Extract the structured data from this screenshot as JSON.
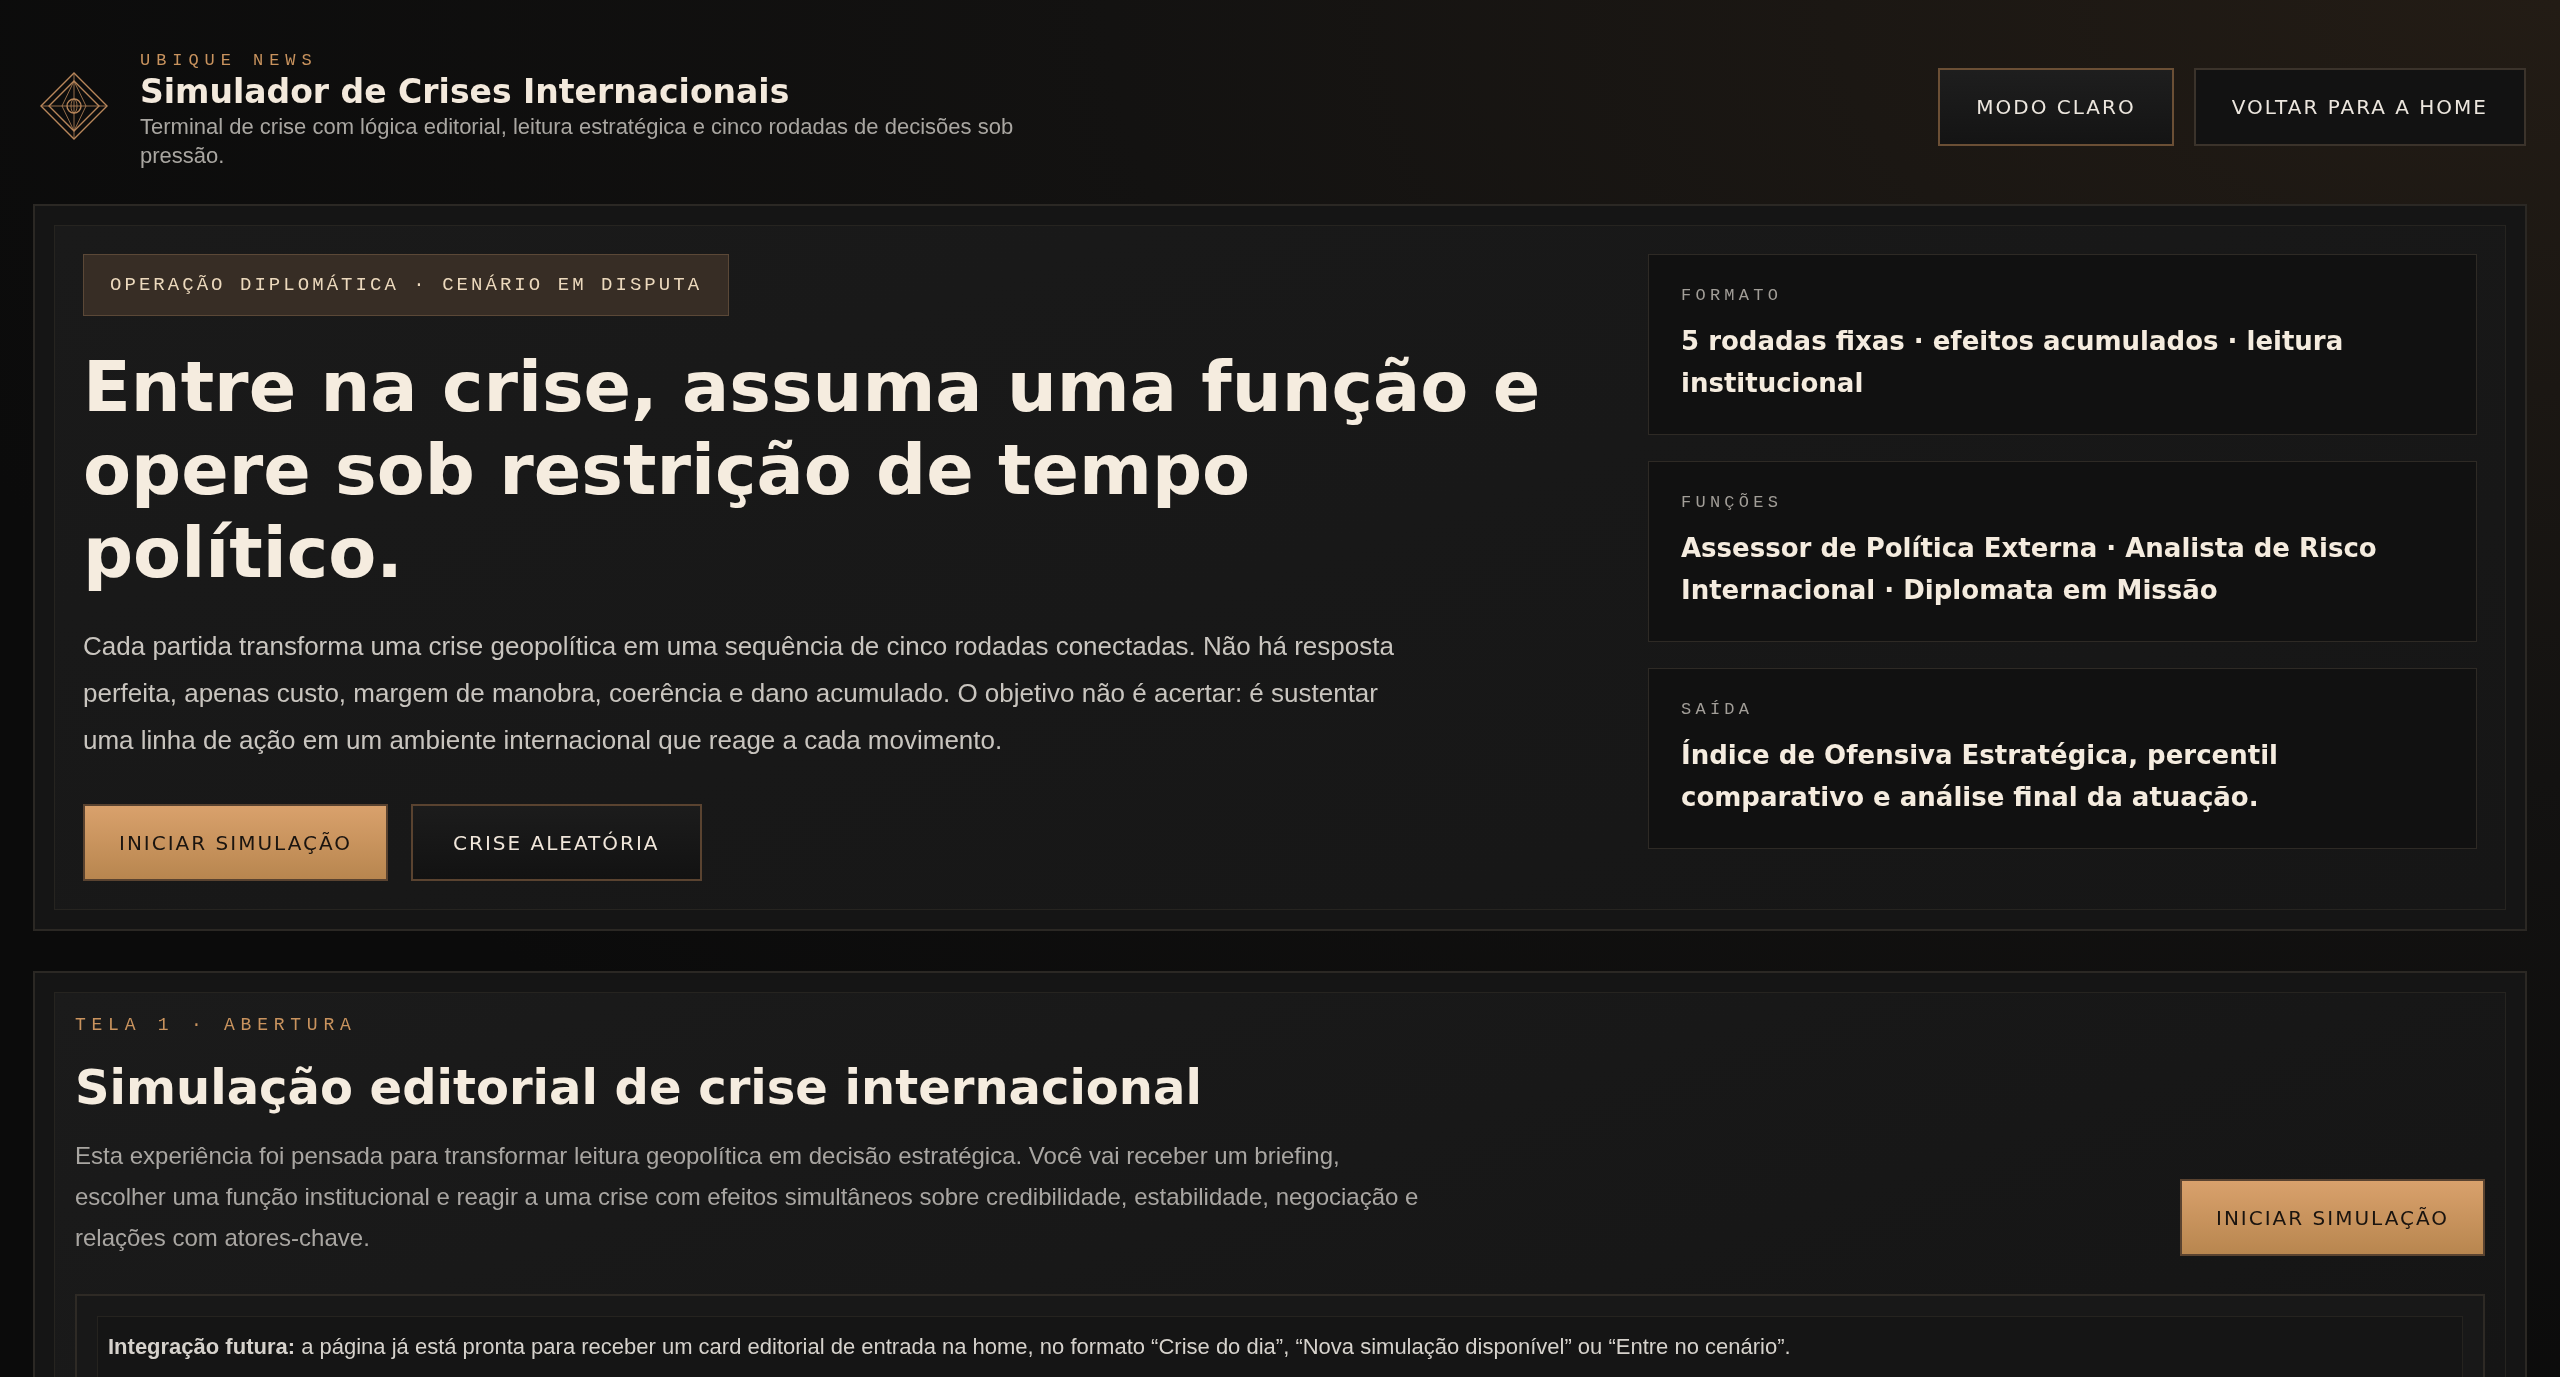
{
  "header": {
    "eyebrow": "UBIQUE NEWS",
    "title": "Simulador de Crises Internacionais",
    "subtitle": "Terminal de crise com lógica editorial, leitura estratégica e cinco rodadas de decisões sob pressão.",
    "buttons": [
      {
        "label": "MODO CLARO",
        "kind": "accent"
      },
      {
        "label": "VOLTAR PARA A HOME",
        "kind": "plain"
      }
    ]
  },
  "hero": {
    "badge": "OPERAÇÃO DIPLOMÁTICA · CENÁRIO EM DISPUTA",
    "headline": "Entre na crise, assuma uma função e opere sob restrição de tempo político.",
    "body": "Cada partida transforma uma crise geopolítica em uma sequência de cinco rodadas conectadas. Não há resposta perfeita, apenas custo, margem de manobra, coerência e dano acumulado. O objetivo não é acertar: é sustentar uma linha de ação em um ambiente internacional que reage a cada movimento.",
    "actions": [
      {
        "label": "INICIAR SIMULAÇÃO",
        "kind": "primary"
      },
      {
        "label": "CRISE ALEATÓRIA",
        "kind": "secondary"
      }
    ],
    "info_cards": [
      {
        "label": "FORMATO",
        "value": "5 rodadas fixas · efeitos acumulados · leitura institucional"
      },
      {
        "label": "FUNÇÕES",
        "value": "Assessor de Política Externa · Analista de Risco Internacional · Diplomata em Missão"
      },
      {
        "label": "SAÍDA",
        "value": "Índice de Ofensiva Estratégica, percentil comparativo e análise final da atuação."
      }
    ]
  },
  "intro": {
    "eyebrow": "TELA 1 · ABERTURA",
    "title": "Simulação editorial de crise internacional",
    "body": "Esta experiência foi pensada para transformar leitura geopolítica em decisão estratégica. Você vai receber um briefing, escolher uma função institucional e reagir a uma crise com efeitos simultâneos sobre credibilidade, estabilidade, negociação e relações com atores-chave.",
    "action": {
      "label": "INICIAR SIMULAÇÃO",
      "kind": "primary"
    },
    "note": "**Integração futura:** a página já está pronta para receber um card editorial de entrada na home, no formato “Crise do dia”, “Nova simulação disponível” ou “Entre no cenário”."
  }
}
